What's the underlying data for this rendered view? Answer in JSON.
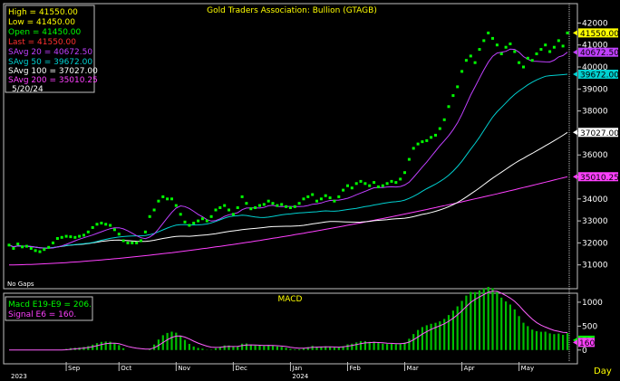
{
  "colors": {
    "background": "#000000",
    "frame": "#c0c0c0",
    "price": "#00ff00",
    "savg20": "#c040ff",
    "savg50": "#00d0d0",
    "savg100": "#ffffff",
    "savg200": "#ff40ff",
    "macd_hist": "#00c000",
    "signal": "#ff60ff",
    "title": "#ffff00",
    "high": "#ffff00",
    "low": "#ffff00",
    "open": "#00ff00",
    "last": "#ff3030",
    "date": "#ffffff",
    "no_gaps": "#ffffff",
    "macd_legend": "#00ff00",
    "signal_legend": "#ff40ff"
  },
  "chart_data": [
    {
      "type": "scatter",
      "title": "Gold Traders Association: Bullion (GTAGB)",
      "ylim": [
        30000,
        42800
      ],
      "y_ticks": [
        31000,
        32000,
        33000,
        34000,
        35000,
        36000,
        37000,
        38000,
        39000,
        40000,
        41000,
        42000
      ],
      "legend": {
        "high": "High   = 41550.00",
        "low": "Low    = 41450.00",
        "open": "Open   = 41450.00",
        "last": "Last   = 41550.00",
        "savg20": "SAvg  20  =  40672.50",
        "savg50": "SAvg  50  =  39672.00",
        "savg100": "SAvg  100  =  37027.00",
        "savg200": "SAvg  200  =  35010.25",
        "date": "5/20/24"
      },
      "note": "No Gaps",
      "value_tags": [
        {
          "value": 41550,
          "label": "41550.00",
          "color": "#ffff00"
        },
        {
          "value": 40672.5,
          "label": "40672.50",
          "color": "#c040ff"
        },
        {
          "value": 39672,
          "label": "39672.00",
          "color": "#00d0d0"
        },
        {
          "value": 37027,
          "label": "37027.00",
          "color": "#ffffff"
        },
        {
          "value": 35010.25,
          "label": "35010.25",
          "color": "#ff40ff"
        }
      ],
      "price": [
        31900,
        31750,
        31950,
        31820,
        31850,
        31750,
        31650,
        31600,
        31700,
        31800,
        32000,
        32200,
        32250,
        32300,
        32280,
        32250,
        32300,
        32350,
        32500,
        32700,
        32850,
        32900,
        32850,
        32800,
        32600,
        32400,
        32100,
        32000,
        32000,
        32000,
        32100,
        32500,
        33200,
        33500,
        33900,
        34100,
        34000,
        34000,
        33700,
        33300,
        32950,
        32800,
        32900,
        33000,
        33100,
        33000,
        33200,
        33500,
        33600,
        33700,
        33500,
        33300,
        33600,
        34100,
        33800,
        33550,
        33600,
        33700,
        33750,
        33900,
        33800,
        33700,
        33750,
        33650,
        33600,
        33650,
        33800,
        34000,
        34100,
        34200,
        33900,
        34000,
        34150,
        34050,
        33900,
        34100,
        34400,
        34600,
        34500,
        34700,
        34800,
        34700,
        34600,
        34750,
        34550,
        34600,
        34700,
        34800,
        34750,
        34900,
        35200,
        35800,
        36300,
        36500,
        36600,
        36650,
        36800,
        36900,
        37200,
        37600,
        38200,
        38700,
        39100,
        39800,
        40300,
        40500,
        40200,
        40800,
        41200,
        41550,
        41300,
        41000,
        40600,
        40900,
        41050,
        40700,
        40200,
        40000,
        40400,
        40300,
        40600,
        40800,
        41000,
        40700,
        40900,
        41200,
        40950,
        41550
      ],
      "savg_20_end": 40672.5,
      "savg_50_end": 39672,
      "savg_100_end": 37027,
      "savg_200_start": 31000,
      "savg_200_end": 35010.25,
      "x_labels": [
        {
          "label": "Sep",
          "index": 13
        },
        {
          "label": "Oct",
          "index": 25
        },
        {
          "label": "Nov",
          "index": 38
        },
        {
          "label": "Dec",
          "index": 51
        },
        {
          "label": "Jan",
          "index": 64
        },
        {
          "label": "Feb",
          "index": 77
        },
        {
          "label": "Mar",
          "index": 90
        },
        {
          "label": "Apr",
          "index": 103
        },
        {
          "label": "May",
          "index": 116
        }
      ],
      "year_labels": [
        {
          "label": "2023",
          "index": 0
        },
        {
          "label": "2024",
          "index": 64
        }
      ],
      "x_axis_caption": "Day"
    },
    {
      "type": "bar",
      "title": "MACD",
      "ylim": [
        -250,
        1150
      ],
      "y_ticks": [
        0,
        500,
        1000
      ],
      "legend": {
        "macd": "Macd  E19-E9  =  206.",
        "signal": "Signal  E6  =  160."
      },
      "value_tags": [
        {
          "value": 206,
          "label": "206",
          "color": "#00ff00"
        },
        {
          "value": 160,
          "label": "160",
          "color": "#ff40ff"
        }
      ]
    }
  ]
}
